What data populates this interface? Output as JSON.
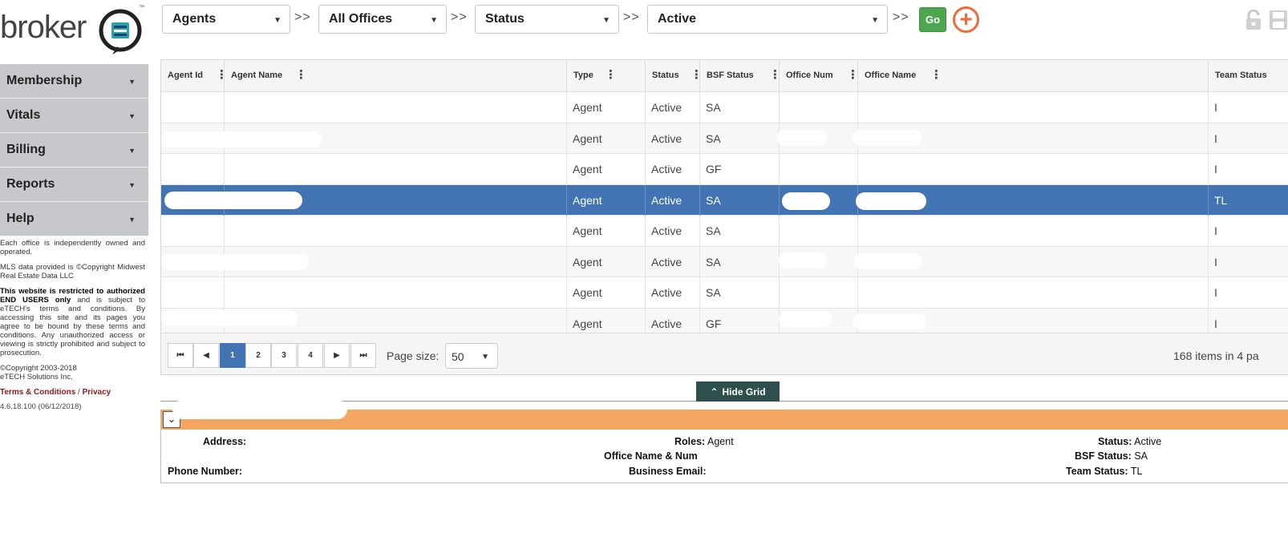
{
  "logo": {
    "text": "broker",
    "tm": "™"
  },
  "filters": {
    "select1": "Agents",
    "select2": "All Offices",
    "select3": "Status",
    "select4": "Active",
    "separator": ">>",
    "go_label": "Go",
    "add_label": "+"
  },
  "sidebar": {
    "items": [
      {
        "label": "Membership"
      },
      {
        "label": "Vitals"
      },
      {
        "label": "Billing"
      },
      {
        "label": "Reports"
      },
      {
        "label": "Help"
      }
    ],
    "note1": "Each office is independently owned and operated.",
    "note2": "MLS data provided is ©Copyright Midwest Real Estate Data LLC",
    "note3_bold": "This website is restricted to authorized END USERS only",
    "note3_rest": " and is subject to eTECH's terms and conditions. By accessing this site and its pages you agree to be bound by these terms and conditions. Any unauthorized access or viewing is strictly prohibited and subject to prosecution.",
    "copyright1": "©Copyright 2003-2018",
    "copyright2": "eTECH Solutions Inc.",
    "terms_link": "Terms & Conditions",
    "link_sep": "/",
    "privacy_link": "Privacy",
    "version": "4.6.18.100 (06/12/2018)"
  },
  "grid": {
    "columns": [
      "Agent Id",
      "Agent Name",
      "Type",
      "Status",
      "BSF Status",
      "Office Num",
      "Office Name",
      "Team Status"
    ],
    "rows": [
      {
        "type": "Agent",
        "status": "Active",
        "bsf": "SA",
        "team": "I"
      },
      {
        "type": "Agent",
        "status": "Active",
        "bsf": "SA",
        "team": "I"
      },
      {
        "type": "Agent",
        "status": "Active",
        "bsf": "GF",
        "team": "I"
      },
      {
        "type": "Agent",
        "status": "Active",
        "bsf": "SA",
        "team": "TL"
      },
      {
        "type": "Agent",
        "status": "Active",
        "bsf": "SA",
        "team": "I"
      },
      {
        "type": "Agent",
        "status": "Active",
        "bsf": "SA",
        "team": "I"
      },
      {
        "type": "Agent",
        "status": "Active",
        "bsf": "SA",
        "team": "I"
      },
      {
        "type": "Agent",
        "status": "Active",
        "bsf": "GF",
        "team": "I"
      }
    ]
  },
  "pager": {
    "first": "⏮",
    "prev": "◀",
    "pages": [
      "1",
      "2",
      "3",
      "4"
    ],
    "next": "▶",
    "last": "⏭",
    "size_label": "Page size:",
    "size_value": "50",
    "info": "168 items in 4 pa"
  },
  "hide_grid": {
    "label": "Hide Grid"
  },
  "detail": {
    "toggle": "⌄",
    "address_label": "Address:",
    "phone_label": "Phone Number:",
    "roles_label": "Roles:",
    "roles_value": "Agent",
    "office_label": "Office Name & Num",
    "business_email_label": "Business Email:",
    "status_label": "Status:",
    "status_value": "Active",
    "bsf_label": "BSF Status:",
    "bsf_value": "SA",
    "team_label": "Team Status:",
    "team_value": "TL"
  }
}
